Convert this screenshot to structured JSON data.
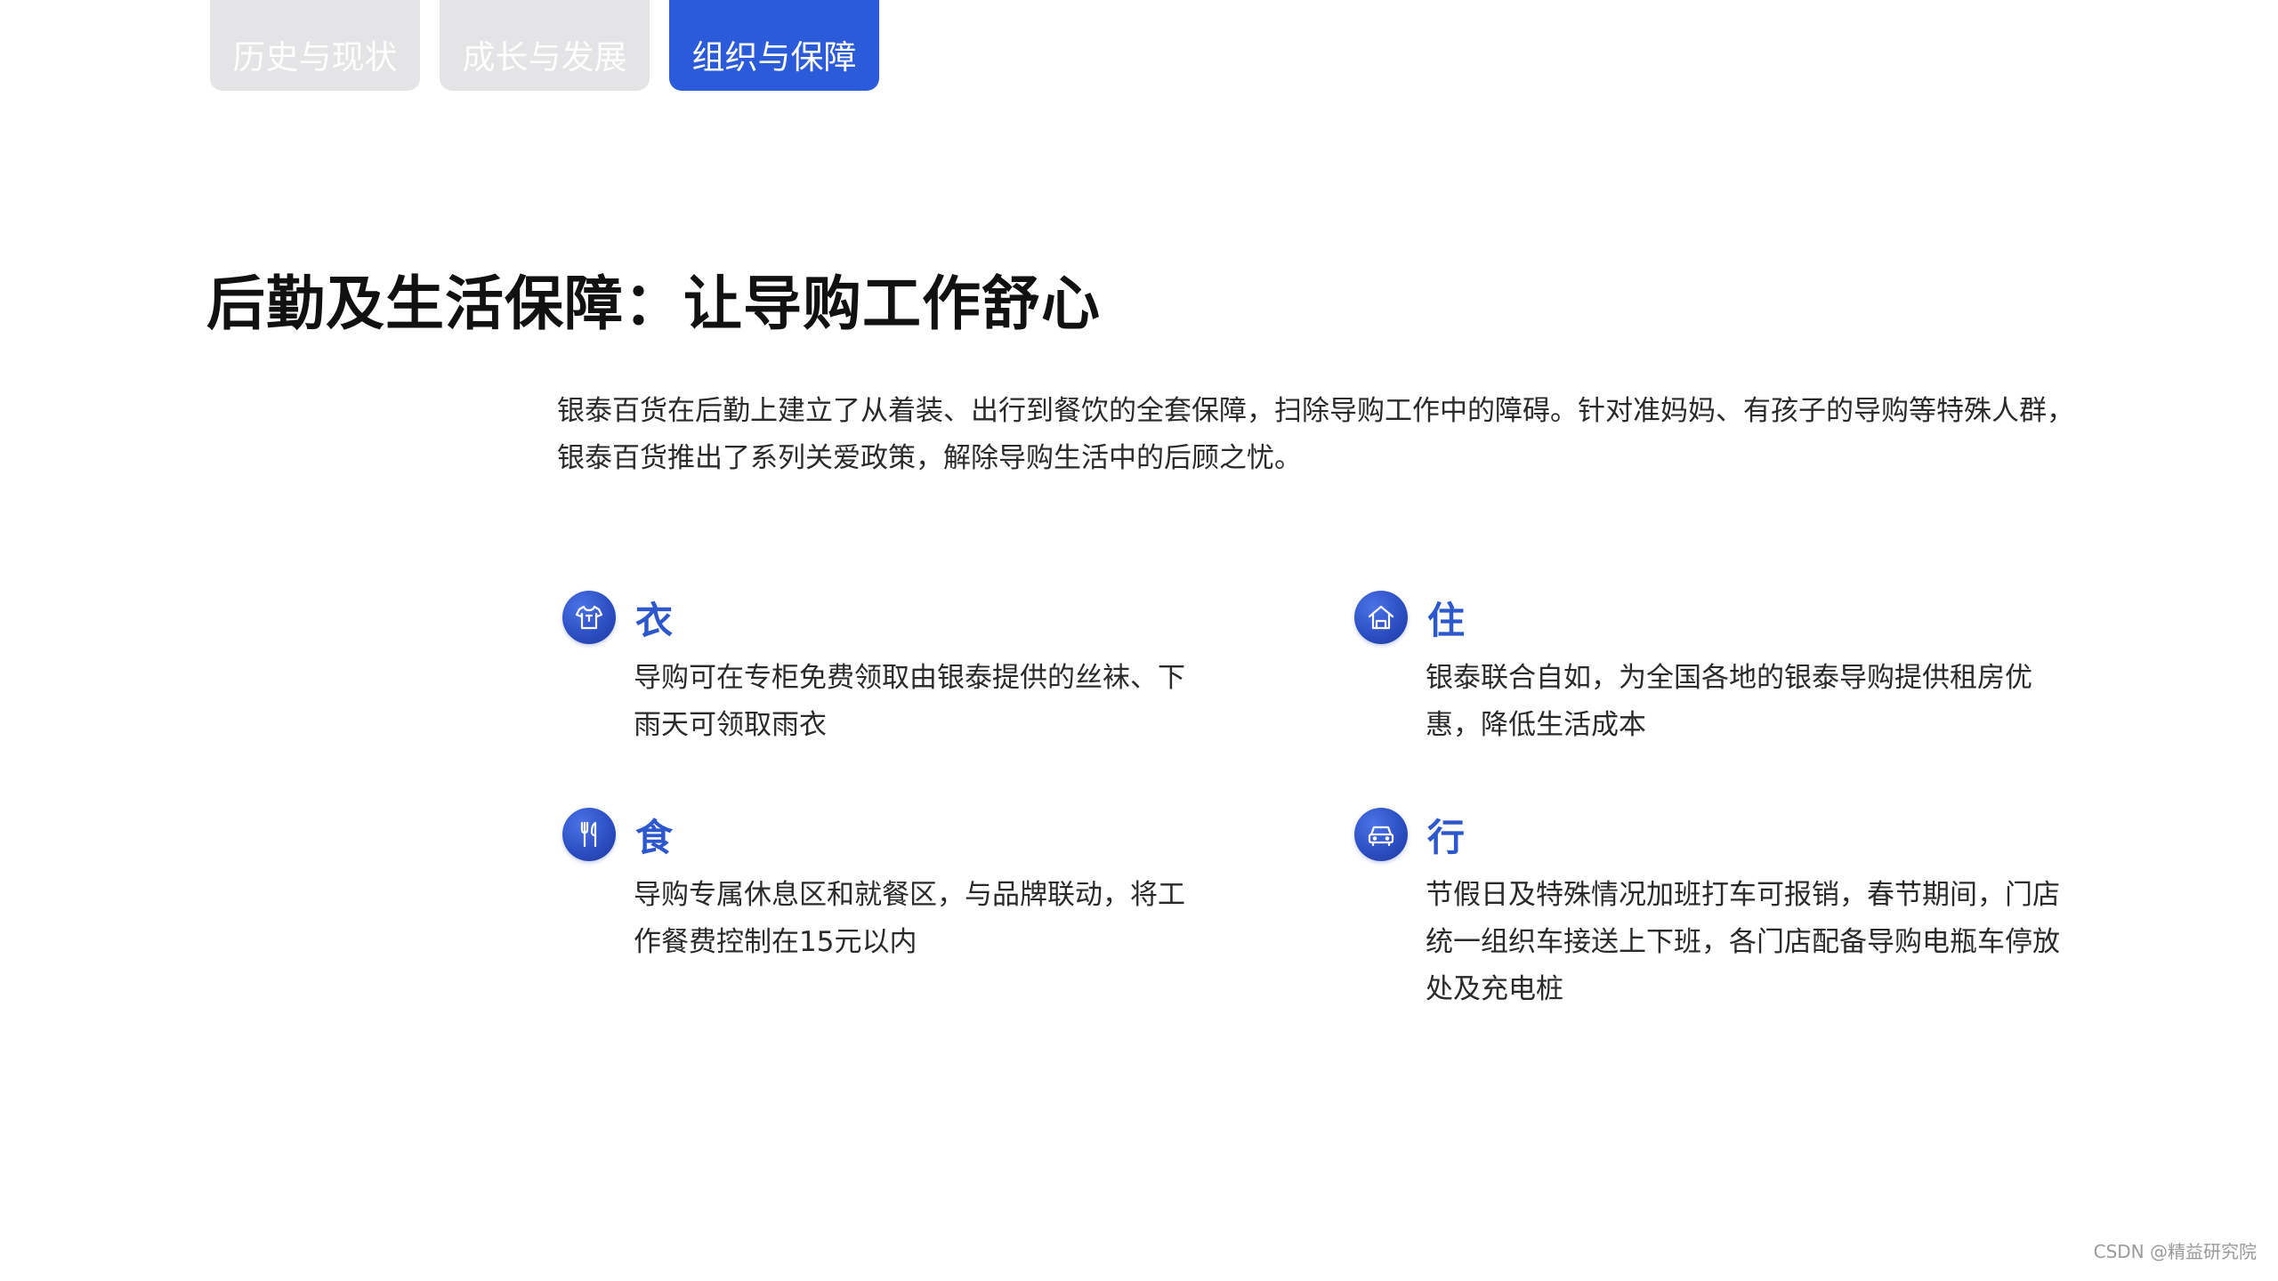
{
  "tabs": [
    {
      "label": "历史与现状",
      "active": false
    },
    {
      "label": "成长与发展",
      "active": false
    },
    {
      "label": "组织与保障",
      "active": true
    }
  ],
  "page": {
    "title": "后勤及生活保障：让导购工作舒心",
    "intro": "银泰百货在后勤上建立了从着装、出行到餐饮的全套保障，扫除导购工作中的障碍。针对准妈妈、有孩子的导购等特殊人群，银泰百货推出了系列关爱政策，解除导购生活中的后顾之忧。"
  },
  "features": {
    "clothing": {
      "icon": "shirt-icon",
      "title": "衣",
      "desc": "导购可在专柜免费领取由银泰提供的丝袜、下雨天可领取雨衣"
    },
    "housing": {
      "icon": "house-icon",
      "title": "住",
      "desc": "银泰联合自如，为全国各地的银泰导购提供租房优惠，降低生活成本"
    },
    "food": {
      "icon": "utensils-icon",
      "title": "食",
      "desc": "导购专属休息区和就餐区，与品牌联动，将工作餐费控制在15元以内"
    },
    "travel": {
      "icon": "car-icon",
      "title": "行",
      "desc": "节假日及特殊情况加班打车可报销，春节期间，门店统一组织车接送上下班，各门店配备导购电瓶车停放处及充电桩"
    }
  },
  "watermark": "CSDN @精益研究院"
}
